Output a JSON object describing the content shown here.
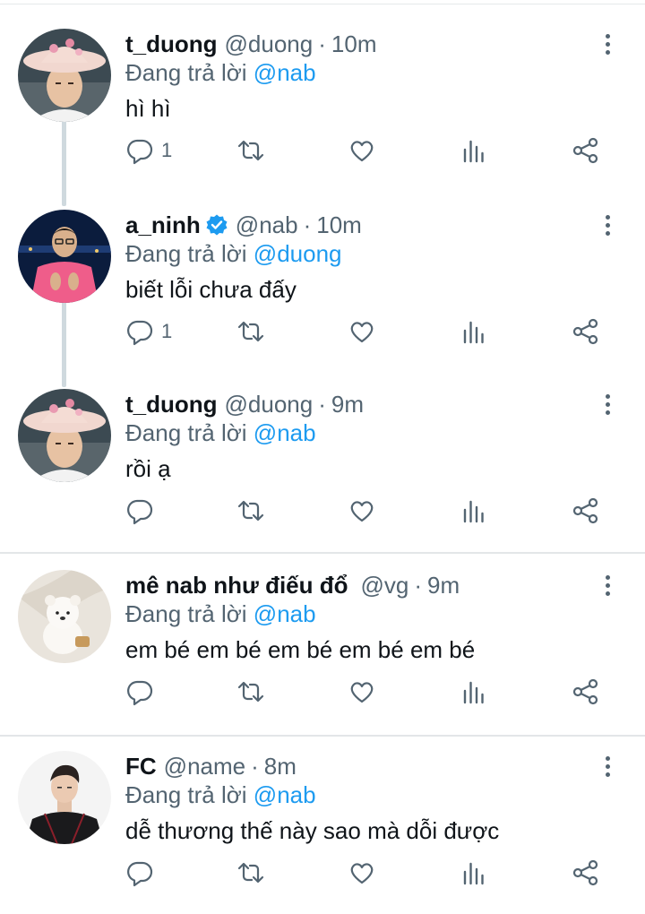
{
  "tweets": [
    {
      "name": "t_duong",
      "verified": false,
      "handle": "@duong",
      "time": "10m",
      "reply_prefix": "Đang trả lời",
      "reply_to": "@nab",
      "text": "hì hì",
      "reply_count": "1",
      "avatar": "avatar-pink-hat"
    },
    {
      "name": "a_ninh",
      "verified": true,
      "handle": "@nab",
      "time": "10m",
      "reply_prefix": "Đang trả lời",
      "reply_to": "@duong",
      "text": "biết lỗi chưa đấy",
      "reply_count": "1",
      "avatar": "avatar-pink-shirt"
    },
    {
      "name": "t_duong",
      "verified": false,
      "handle": "@duong",
      "time": "9m",
      "reply_prefix": "Đang trả lời",
      "reply_to": "@nab",
      "text": "rồi ạ",
      "reply_count": "",
      "avatar": "avatar-pink-hat"
    },
    {
      "name": "mê nab như điếu đổ",
      "verified": false,
      "handle": "@vg",
      "time": "9m",
      "reply_prefix": "Đang trả lời",
      "reply_to": "@nab",
      "text": "em bé em bé em bé em bé em bé",
      "reply_count": "",
      "avatar": "avatar-plush-bear"
    },
    {
      "name": "FC",
      "verified": false,
      "handle": "@name",
      "time": "8m",
      "reply_prefix": "Đang trả lời",
      "reply_to": "@nab",
      "text": "dễ thương thế này sao mà dỗi được",
      "reply_count": "",
      "avatar": "avatar-black-top"
    }
  ],
  "separator": "·",
  "colors": {
    "link": "#1d9bf0",
    "secondary": "#536471",
    "verified": "#1d9bf0",
    "divider": "#e3e6e8",
    "thread_line": "#cfd9de"
  },
  "icons": [
    "reply-icon",
    "retweet-icon",
    "like-icon",
    "views-icon",
    "share-icon",
    "more-icon",
    "verified-badge-icon"
  ]
}
